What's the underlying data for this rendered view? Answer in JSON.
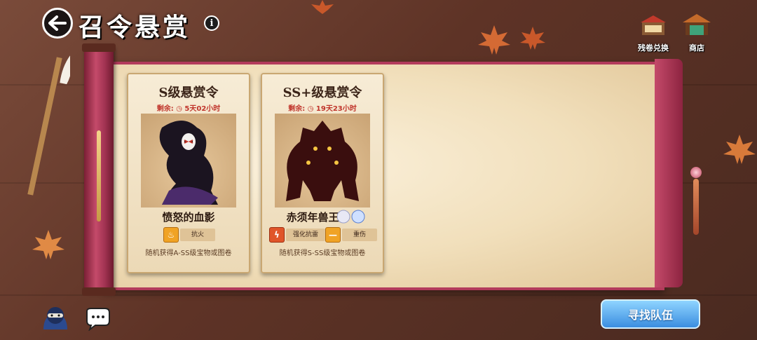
{
  "header": {
    "title": "召令悬赏",
    "info": "i"
  },
  "top_buttons": [
    {
      "label": "残卷兑换",
      "icon": "scroll-exchange-icon"
    },
    {
      "label": "商店",
      "icon": "shop-icon"
    }
  ],
  "cards": [
    {
      "title": "S级悬赏令",
      "remaining_label": "剩余:",
      "remaining_time": "5天02小时",
      "boss_name": "愤怒的血影",
      "traits": [
        {
          "label": "抗火",
          "icon": "fire-resist-icon"
        }
      ],
      "reward": "随机获得A-SS级宝物或图卷"
    },
    {
      "title": "SS+级悬赏令",
      "remaining_label": "剩余:",
      "remaining_time": "19天23小时",
      "boss_name": "赤须年兽王",
      "traits": [
        {
          "label": "强化抗雷",
          "icon": "thunder-resist-icon"
        },
        {
          "label": "重伤",
          "icon": "heavy-wound-icon"
        }
      ],
      "reward": "随机获得S-SS级宝物或图卷"
    }
  ],
  "bottom": {
    "find_team_label": "寻找队伍"
  },
  "colors": {
    "scroll_trim": "#b33b5c",
    "timer_red": "#c0342b",
    "button_blue": "#3b8ee0"
  }
}
